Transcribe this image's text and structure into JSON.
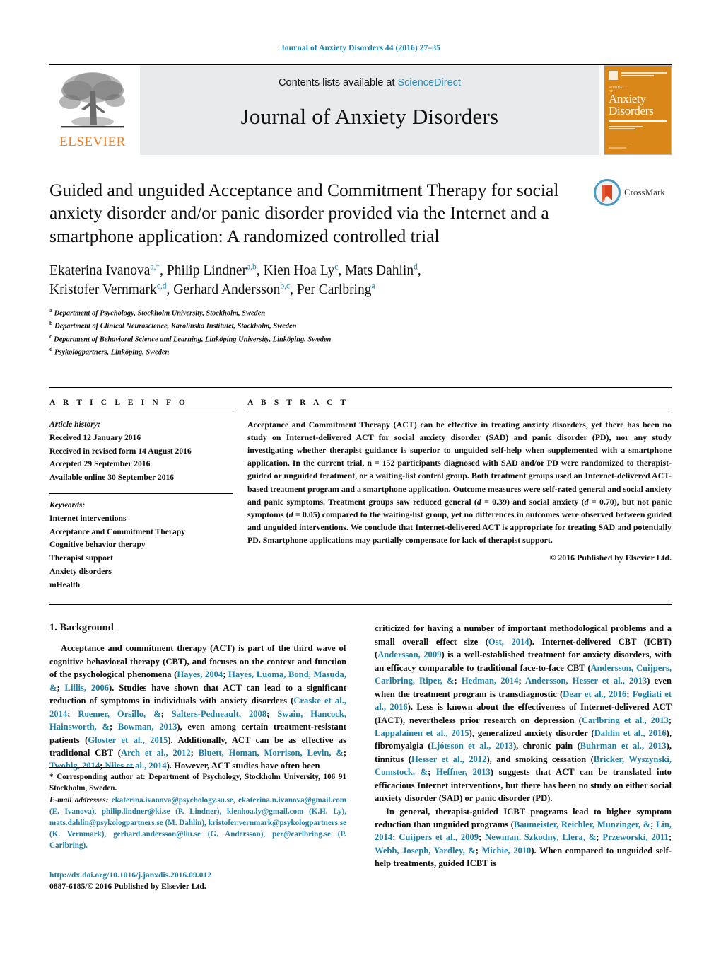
{
  "running_head": "Journal of Anxiety Disorders 44 (2016) 27–35",
  "masthead": {
    "publisher_name": "ELSEVIER",
    "contents_prefix": "Contents lists available at ",
    "contents_link": "ScienceDirect",
    "journal_title": "Journal of Anxiety Disorders",
    "cover": {
      "kicker1": "JOURNAL",
      "kicker2": "OF",
      "line1": "Anxiety",
      "line2": "Disorders",
      "editor_line1": "Editor-in-Chief",
      "editor_line2": "Peter J. Norton"
    }
  },
  "article": {
    "title": "Guided and unguided Acceptance and Commitment Therapy for social anxiety disorder and/or panic disorder provided via the Internet and a smartphone application: A randomized controlled trial",
    "crossmark_label": "CrossMark",
    "authors_line1_parts": [
      {
        "name": "Ekaterina Ivanova",
        "sup": "a,*"
      },
      {
        "name": "Philip Lindner",
        "sup": "a,b"
      },
      {
        "name": "Kien Hoa Ly",
        "sup": "c"
      },
      {
        "name": "Mats Dahlin",
        "sup": "d"
      }
    ],
    "authors_line2_parts": [
      {
        "name": "Kristofer Vernmark",
        "sup": "c,d"
      },
      {
        "name": "Gerhard Andersson",
        "sup": "b,c"
      },
      {
        "name": "Per Carlbring",
        "sup": "a"
      }
    ],
    "affiliations": [
      {
        "marker": "a",
        "text": "Department of Psychology, Stockholm University, Stockholm, Sweden"
      },
      {
        "marker": "b",
        "text": "Department of Clinical Neuroscience, Karolinska Institutet, Stockholm, Sweden"
      },
      {
        "marker": "c",
        "text": "Department of Behavioral Science and Learning, Linköping University, Linköping, Sweden"
      },
      {
        "marker": "d",
        "text": "Psykologpartners, Linköping, Sweden"
      }
    ]
  },
  "article_info": {
    "heading": "A R T I C L E    I N F O",
    "history_label": "Article history:",
    "history": [
      "Received 12 January 2016",
      "Received in revised form 14 August 2016",
      "Accepted 29 September 2016",
      "Available online 30 September 2016"
    ],
    "keywords_label": "Keywords:",
    "keywords": [
      "Internet interventions",
      "Acceptance and Commitment Therapy",
      "Cognitive behavior therapy",
      "Therapist support",
      "Anxiety disorders",
      "mHealth"
    ]
  },
  "abstract": {
    "heading": "A B S T R A C T",
    "text": "Acceptance and Commitment Therapy (ACT) can be effective in treating anxiety disorders, yet there has been no study on Internet-delivered ACT for social anxiety disorder (SAD) and panic disorder (PD), nor any study investigating whether therapist guidance is superior to unguided self-help when supplemented with a smartphone application. In the current trial, n = 152 participants diagnosed with SAD and/or PD were randomized to therapist-guided or unguided treatment, or a waiting-list control group. Both treatment groups used an Internet-delivered ACT-based treatment program and a smartphone application. Outcome measures were self-rated general and social anxiety and panic symptoms. Treatment groups saw reduced general (d = 0.39) and social anxiety (d = 0.70), but not panic symptoms (d = 0.05) compared to the waiting-list group, yet no differences in outcomes were observed between guided and unguided interventions. We conclude that Internet-delivered ACT is appropriate for treating SAD and potentially PD. Smartphone applications may partially compensate for lack of therapist support.",
    "copyright": "© 2016 Published by Elsevier Ltd."
  },
  "body": {
    "section_number_title": "1. Background",
    "left_paragraph_1": "Acceptance and commitment therapy (ACT) is part of the third wave of cognitive behavioral therapy (CBT), and focuses on the context and function of the psychological phenomena (Hayes, 2004; Hayes, Luoma, Bond, Masuda, & Lillis, 2006). Studies have shown that ACT can lead to a significant reduction of symptoms in individuals with anxiety disorders (Craske et al., 2014; Roemer, Orsillo, & Salters-Pedneault, 2008; Swain, Hancock, Hainsworth, & Bowman, 2013), even among certain treatment-resistant patients (Gloster et al., 2015). Additionally, ACT can be as effective as traditional CBT (Arch et al., 2012; Bluett, Homan, Morrison, Levin, & Twohig, 2014; Niles et al., 2014). However, ACT studies have often been",
    "right_paragraph_1": "criticized for having a number of important methodological problems and a small overall effect size (Ost, 2014). Internet-delivered CBT (ICBT) (Andersson, 2009) is a well-established treatment for anxiety disorders, with an efficacy comparable to traditional face-to-face CBT (Andersson, Cuijpers, Carlbring, Riper, & Hedman, 2014; Andersson, Hesser et al., 2013) even when the treatment program is transdiagnostic (Dear et al., 2016; Fogliati et al., 2016). Less is known about the effectiveness of Internet-delivered ACT (IACT), nevertheless prior research on depression (Carlbring et al., 2013; Lappalainen et al., 2015), generalized anxiety disorder (Dahlin et al., 2016), fibromyalgia (Ljótsson et al., 2013), chronic pain (Buhrman et al., 2013), tinnitus (Hesser et al., 2012), and smoking cessation (Bricker, Wyszynski, Comstock, & Heffner, 2013) suggests that ACT can be translated into efficacious Internet interventions, but there has been no study on either social anxiety disorder (SAD) or panic disorder (PD).",
    "right_paragraph_2": "In general, therapist-guided ICBT programs lead to higher symptom reduction than unguided programs (Baumeister, Reichler, Munzinger, & Lin, 2014; Cuijpers et al., 2009; Newman, Szkodny, Llera, & Przeworski, 2011; Webb, Joseph, Yardley, & Michie, 2010). When compared to unguided self-help treatments, guided ICBT is"
  },
  "footnotes": {
    "corresponding": "* Corresponding author at: Department of Psychology, Stockholm University, 106 91 Stockholm, Sweden.",
    "email_label": "E-mail addresses:",
    "emails_text": "ekaterina.ivanova@psychology.su.se, ekaterina.n.ivanova@gmail.com (E. Ivanova), philip.lindner@ki.se (P. Lindner), kienhoa.ly@gmail.com (K.H. Ly), mats.dahlin@psykologpartners.se (M. Dahlin), kristofer.vernmark@psykologpartners.se (K. Vernmark), gerhard.andersson@liu.se (G. Andersson), per@carlbring.se (P. Carlbring).",
    "doi": "http://dx.doi.org/10.1016/j.janxdis.2016.09.012",
    "issn": "0887-6185/© 2016 Published by Elsevier Ltd."
  },
  "colors": {
    "link_blue": "#1a7fa8",
    "sciencedirect_blue": "#2b8fc4",
    "elsevier_orange": "#f47b20",
    "cover_orange": "#d98718",
    "band_gray": "#e9eaec"
  }
}
